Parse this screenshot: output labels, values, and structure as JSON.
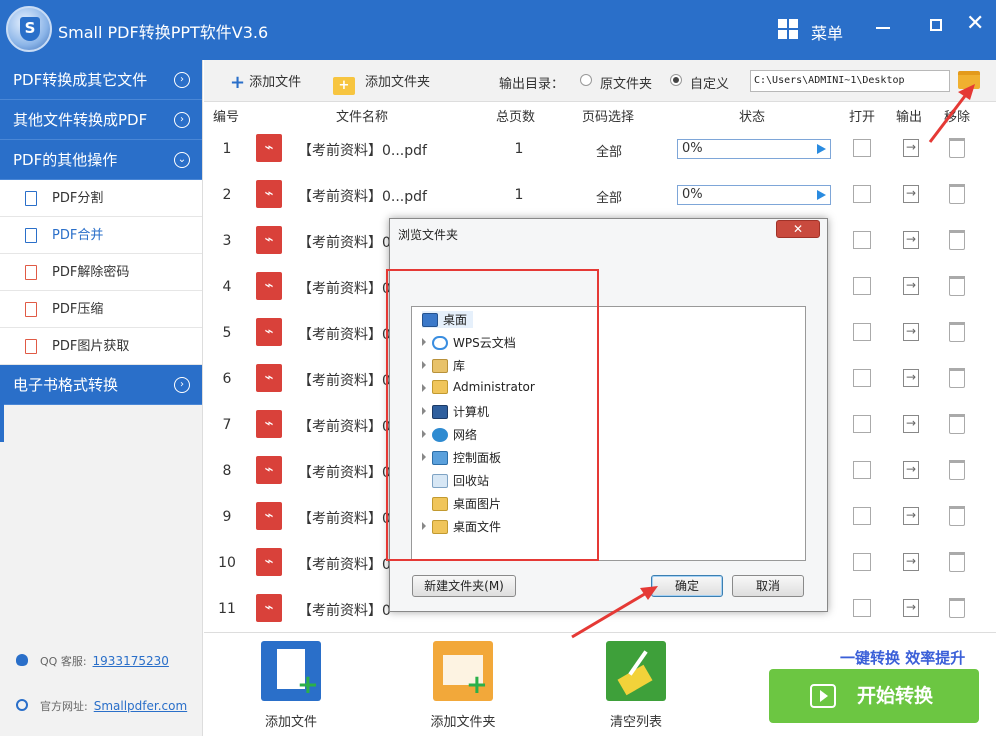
{
  "app": {
    "title": "Small PDF转换PPT软件V3.6",
    "menu_label": "菜单",
    "logo_letter": "S"
  },
  "sidebar": {
    "sections": [
      {
        "label": "PDF转换成其它文件"
      },
      {
        "label": "其他文件转换成PDF"
      },
      {
        "label": "PDF的其他操作"
      },
      {
        "label": "电子书格式转换"
      }
    ],
    "items": [
      {
        "label": "PDF分割",
        "icon": "pdf-file-icon"
      },
      {
        "label": "PDF合并",
        "icon": "pdf-file-icon",
        "active": true
      },
      {
        "label": "PDF解除密码",
        "icon": "pdf-file-icon"
      },
      {
        "label": "PDF压缩",
        "icon": "pdf-file-icon"
      },
      {
        "label": "PDF图片获取",
        "icon": "pdf-file-icon"
      }
    ],
    "qq_label": "QQ 客服:",
    "qq_number": "1933175230",
    "site_label": "官方网址:",
    "site_url": "Smallpdfer.com"
  },
  "toolbar": {
    "add_file": "添加文件",
    "add_folder": "添加文件夹",
    "output_label": "输出目录：",
    "radio_original": "原文件夹",
    "radio_custom": "自定义",
    "path": "C:\\Users\\ADMINI~1\\Desktop"
  },
  "table": {
    "headers": [
      "编号",
      "文件名称",
      "总页数",
      "页码选择",
      "状态",
      "打开",
      "输出",
      "移除"
    ],
    "rows": [
      {
        "num": "1",
        "name": "【考前资料】0...pdf",
        "pages": "1",
        "range": "全部",
        "progress": "0%"
      },
      {
        "num": "2",
        "name": "【考前资料】0...pdf",
        "pages": "1",
        "range": "全部",
        "progress": "0%"
      },
      {
        "num": "3",
        "name": "【考前资料】0"
      },
      {
        "num": "4",
        "name": "【考前资料】0"
      },
      {
        "num": "5",
        "name": "【考前资料】0"
      },
      {
        "num": "6",
        "name": "【考前资料】0"
      },
      {
        "num": "7",
        "name": "【考前资料】0"
      },
      {
        "num": "8",
        "name": "【考前资料】0"
      },
      {
        "num": "9",
        "name": "【考前资料】0"
      },
      {
        "num": "10",
        "name": "【考前资料】0"
      },
      {
        "num": "11",
        "name": "【考前资料】0"
      }
    ]
  },
  "bottom": {
    "add_file": "添加文件",
    "add_folder": "添加文件夹",
    "clear_list": "清空列表",
    "slogan": "一键转换  效率提升",
    "start": "开始转换"
  },
  "dialog": {
    "title": "浏览文件夹",
    "close": "✕",
    "tree": [
      {
        "label": "桌面",
        "icon": "desktop-icon",
        "selected": true
      },
      {
        "label": "WPS云文档",
        "icon": "cloud-icon"
      },
      {
        "label": "库",
        "icon": "library-icon"
      },
      {
        "label": "Administrator",
        "icon": "user-folder-icon"
      },
      {
        "label": "计算机",
        "icon": "computer-icon"
      },
      {
        "label": "网络",
        "icon": "network-icon"
      },
      {
        "label": "控制面板",
        "icon": "control-panel-icon"
      },
      {
        "label": "回收站",
        "icon": "recycle-bin-icon"
      },
      {
        "label": "桌面图片",
        "icon": "folder-icon"
      },
      {
        "label": "桌面文件",
        "icon": "folder-icon"
      }
    ],
    "new_folder": "新建文件夹(M)",
    "ok": "确定",
    "cancel": "取消"
  },
  "colors": {
    "brand": "#2a6fc9",
    "start_button": "#6cc642",
    "annotation": "#e53935",
    "pdf_red": "#d9413a"
  }
}
